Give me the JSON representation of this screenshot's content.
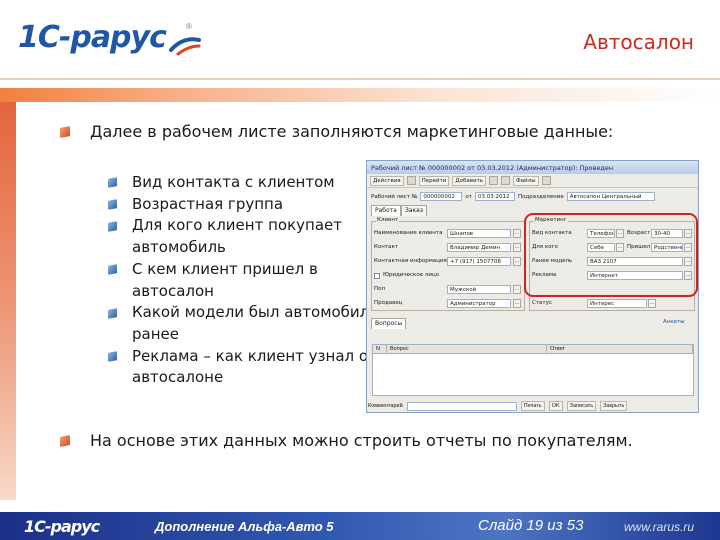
{
  "header": {
    "logo_text": "1С-рарус",
    "title": "Автосалон"
  },
  "content": {
    "intro": "Далее в рабочем листе заполняются маркетинговые данные:",
    "items": [
      "Вид контакта с клиентом",
      "Возрастная группа",
      "Для кого клиент покупает",
      "автомобиль",
      "С кем клиент пришел в",
      "автосалон",
      "Какой модели был автомобиль",
      "ранее",
      "Реклама – как клиент узнал об",
      "автосалоне"
    ],
    "summary": "На основе этих данных можно строить отчеты по покупателям."
  },
  "window": {
    "title": "Рабочий лист № 000000002 от 03.03.2012 (Администратор): Проведен",
    "toolbar": [
      "Действия",
      "Перейти",
      "Добавить",
      "Файлы"
    ],
    "row1_label": "Рабочий лист №",
    "row1_number": "000000002",
    "row1_from": "от",
    "row1_date": "03.03.2012",
    "row1_dept_label": "Подразделение",
    "row1_dept": "Автосалон Центральный",
    "tabs": [
      "Работа",
      "Заказ"
    ],
    "client_group": "Клиент",
    "client_fields": [
      {
        "label": "Наименование клиента",
        "value": "Шнапов"
      },
      {
        "label": "Контакт",
        "value": "Владимир Демин"
      },
      {
        "label": "Контактная информация",
        "value": "+7 (917) 1507708"
      },
      {
        "label": "Юридическое лицо",
        "value": ""
      },
      {
        "label": "Пол",
        "value": "Мужской"
      },
      {
        "label": "Продавец",
        "value": "Администратор"
      }
    ],
    "marketing_group": "Маркетинг",
    "marketing_fields": [
      {
        "label": "Вид контакта",
        "value": "Телефон"
      },
      {
        "label": "Для кого",
        "value": "Себе"
      },
      {
        "label": "Пришел вместе",
        "value": "Родственник"
      },
      {
        "label": "Ранее модель",
        "value": "ВАЗ 2107"
      },
      {
        "label": "Реклама",
        "value": "Интернет"
      },
      {
        "label": "Статус",
        "value": "Интерес"
      }
    ],
    "age_label": "Возраст",
    "age_value": "30-40",
    "grid_tab": "Вопросы",
    "grid_link": "Анкеты",
    "grid_columns": [
      "N",
      "Вопрос",
      "Ответ"
    ],
    "comment_label": "Комментарий",
    "bottom_buttons": [
      "Печать",
      "OK",
      "Записать",
      "Закрыть"
    ]
  },
  "footer": {
    "logo_text": "1С-рарус",
    "title": "Дополнение Альфа-Авто 5",
    "slide": "Слайд 19 из 53",
    "url": "www.rarus.ru"
  }
}
